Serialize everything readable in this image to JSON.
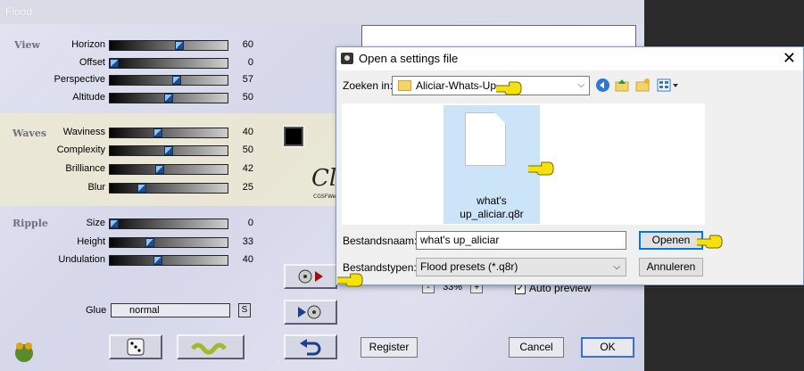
{
  "flood": {
    "title": "Flood",
    "sections": {
      "view": "View",
      "waves": "Waves",
      "ripple": "Ripple"
    },
    "view": [
      {
        "label": "Horizon",
        "value": "60",
        "level": 0.6
      },
      {
        "label": "Offset",
        "value": "0",
        "level": 0.0
      },
      {
        "label": "Perspective",
        "value": "57",
        "level": 0.57
      },
      {
        "label": "Altitude",
        "value": "50",
        "level": 0.5
      }
    ],
    "waves": [
      {
        "label": "Waviness",
        "value": "40",
        "level": 0.4
      },
      {
        "label": "Complexity",
        "value": "50",
        "level": 0.5
      },
      {
        "label": "Brilliance",
        "value": "42",
        "level": 0.42
      },
      {
        "label": "Blur",
        "value": "25",
        "level": 0.25
      }
    ],
    "ripple": [
      {
        "label": "Size",
        "value": "0",
        "level": 0.0
      },
      {
        "label": "Height",
        "value": "33",
        "level": 0.33
      },
      {
        "label": "Undulation",
        "value": "40",
        "level": 0.4
      }
    ],
    "glue": {
      "label": "Glue",
      "value": "normal",
      "s_button": "S"
    },
    "zoom": {
      "minus": "-",
      "value": "33%",
      "plus": "+"
    },
    "auto_preview": {
      "label": "Auto preview",
      "checked": true
    },
    "buttons": {
      "register": "Register",
      "cancel": "Cancel",
      "ok": "OK"
    },
    "watermark": {
      "name": "Claudia",
      "sub": "CGSFWebdesign"
    },
    "colors": {
      "wave_color": "#000000",
      "accent": "#3b6fd6"
    }
  },
  "dialog": {
    "title": "Open a settings file",
    "close": "✕",
    "look_in_label": "Zoeken in:",
    "look_in_value": "Aliciar-Whats-Up",
    "file": {
      "line1": "what's",
      "line2": "up_aliciar.q8r"
    },
    "filename_label": "Bestandsnaam:",
    "filename_value": "what's up_aliciar",
    "filetype_label": "Bestandstypen:",
    "filetype_value": "Flood presets (*.q8r)",
    "open_button": "Openen",
    "cancel_button": "Annuleren"
  }
}
